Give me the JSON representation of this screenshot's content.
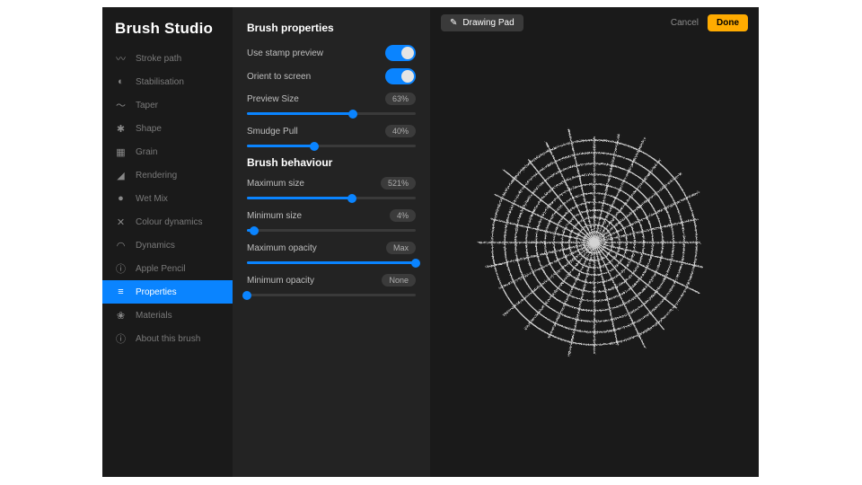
{
  "app_title": "Brush Studio",
  "sidebar": {
    "items": [
      {
        "icon": "stroke-path-icon",
        "glyph": "〰",
        "label": "Stroke path"
      },
      {
        "icon": "stabilisation-icon",
        "glyph": "◐",
        "label": "Stabilisation"
      },
      {
        "icon": "taper-icon",
        "glyph": "〜",
        "label": "Taper"
      },
      {
        "icon": "shape-icon",
        "glyph": "✱",
        "label": "Shape"
      },
      {
        "icon": "grain-icon",
        "glyph": "▦",
        "label": "Grain"
      },
      {
        "icon": "rendering-icon",
        "glyph": "◢",
        "label": "Rendering"
      },
      {
        "icon": "wet-mix-icon",
        "glyph": "●",
        "label": "Wet Mix"
      },
      {
        "icon": "dynamics-color-icon",
        "glyph": "✕",
        "label": "Colour dynamics"
      },
      {
        "icon": "dynamics-icon",
        "glyph": "◠",
        "label": "Dynamics"
      },
      {
        "icon": "apple-pencil-icon",
        "glyph": "ⓘ",
        "label": "Apple Pencil"
      },
      {
        "icon": "properties-icon",
        "glyph": "≡",
        "label": "Properties"
      },
      {
        "icon": "materials-icon",
        "glyph": "❀",
        "label": "Materials"
      },
      {
        "icon": "about-icon",
        "glyph": "ⓘ",
        "label": "About this brush"
      }
    ],
    "selected_index": 10
  },
  "settings": {
    "section1_title": "Brush properties",
    "toggle1": {
      "label": "Use stamp preview",
      "on": true
    },
    "toggle2": {
      "label": "Orient to screen",
      "on": true
    },
    "slider1": {
      "label": "Preview Size",
      "value_label": "63%",
      "fill_pct": 63
    },
    "slider2": {
      "label": "Smudge Pull",
      "value_label": "40%",
      "fill_pct": 40
    },
    "section2_title": "Brush behaviour",
    "slider3": {
      "label": "Maximum size",
      "value_label": "521%",
      "fill_pct": 62
    },
    "slider4": {
      "label": "Minimum size",
      "value_label": "4%",
      "fill_pct": 4
    },
    "slider5": {
      "label": "Maximum opacity",
      "value_label": "Max",
      "fill_pct": 100
    },
    "slider6": {
      "label": "Minimum opacity",
      "value_label": "None",
      "fill_pct": 0
    }
  },
  "preview": {
    "drawing_pad_label": "Drawing Pad",
    "cancel_label": "Cancel",
    "done_label": "Done"
  },
  "colors": {
    "accent": "#0a84ff",
    "done": "#ffab00"
  }
}
